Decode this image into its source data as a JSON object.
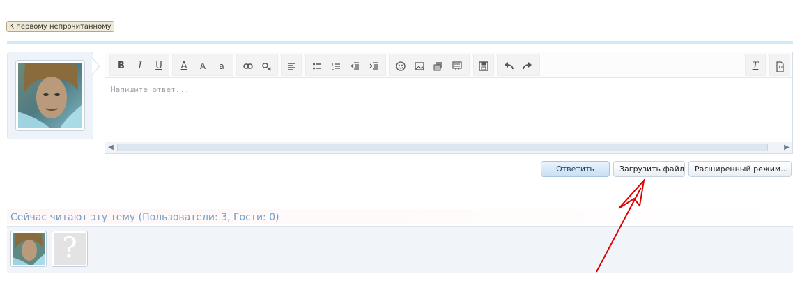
{
  "topnav": {
    "first_unread_label": "К первому непрочитанному"
  },
  "reply": {
    "toolbar": {
      "groups": [
        {
          "buttons": [
            {
              "icon": "bold-icon",
              "glyph": "B"
            },
            {
              "icon": "italic-icon",
              "glyph": "I"
            },
            {
              "icon": "underline-icon",
              "glyph": "U"
            }
          ]
        },
        {
          "buttons": [
            {
              "icon": "font-color-icon",
              "glyph": "A"
            },
            {
              "icon": "font-size-icon",
              "glyph": "A"
            },
            {
              "icon": "font-family-icon",
              "glyph": "a"
            }
          ]
        },
        {
          "buttons": [
            {
              "icon": "link-icon"
            },
            {
              "icon": "unlink-icon"
            }
          ]
        },
        {
          "buttons": [
            {
              "icon": "align-icon"
            }
          ]
        },
        {
          "buttons": [
            {
              "icon": "bulleted-list-icon"
            },
            {
              "icon": "numbered-list-icon"
            },
            {
              "icon": "outdent-icon"
            },
            {
              "icon": "indent-icon"
            }
          ]
        },
        {
          "buttons": [
            {
              "icon": "smilies-icon"
            },
            {
              "icon": "insert-image-icon"
            },
            {
              "icon": "insert-media-icon"
            },
            {
              "icon": "insert-block-icon"
            }
          ]
        },
        {
          "buttons": [
            {
              "icon": "save-draft-icon"
            }
          ]
        },
        {
          "buttons": [
            {
              "icon": "undo-icon"
            },
            {
              "icon": "redo-icon"
            }
          ]
        }
      ],
      "right_buttons": [
        {
          "icon": "remove-format-icon",
          "glyph": "T"
        },
        {
          "icon": "toggle-source-icon"
        }
      ]
    },
    "placeholder": "Напишите ответ...",
    "reply_button": "Ответить",
    "upload_button": "Загрузить файл",
    "advanced_button": "Расширенный режим..."
  },
  "viewers": {
    "title": "Сейчас читают эту тему (Пользователи: 3, Гости: 0)",
    "unknown_glyph": "?"
  },
  "colors": {
    "accent": "#cfe9fa",
    "section_title": "#6ea1c9",
    "annotation_arrow": "#e00000"
  }
}
